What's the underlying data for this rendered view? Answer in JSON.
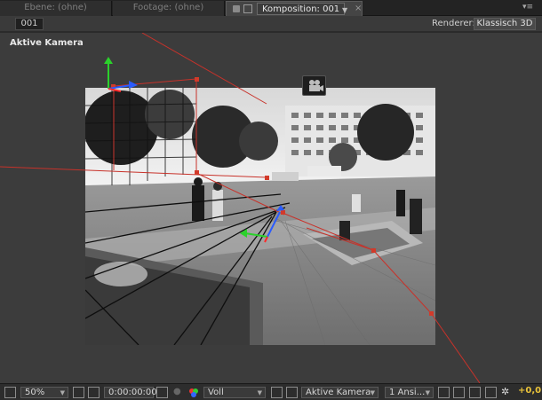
{
  "tabs": [
    {
      "label": "Ebene: (ohne)",
      "active": false
    },
    {
      "label": "Footage: (ohne)",
      "active": false
    },
    {
      "label": "Komposition: 001",
      "active": true
    }
  ],
  "comp_header": {
    "comp_name": "001",
    "renderer_label": "Renderer:",
    "renderer_value": "Klassisch 3D"
  },
  "viewer": {
    "view_label": "Aktive Kamera",
    "camera_button_icon": "camera-icon",
    "axis_colors": {
      "x": "#2a5bff",
      "y": "#2bd12b",
      "z": "#ff2a2a"
    },
    "guide_color": "#d23a2a"
  },
  "toolbar": {
    "magnification": "50%",
    "timecode": "0:00:00:00",
    "resolution": "Voll",
    "view": "Aktive Kamera",
    "layout": "1 Ansi...",
    "exposure": "+0,0"
  }
}
